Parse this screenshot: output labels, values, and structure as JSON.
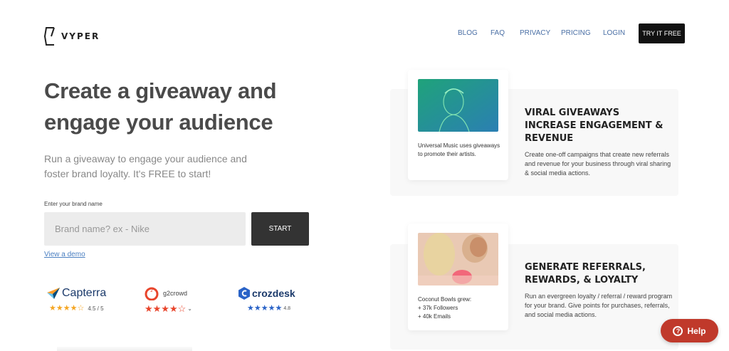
{
  "header": {
    "logo_text": "VYPER",
    "nav": [
      "BLOG",
      "FAQ",
      "PRIVACY",
      "PRICING",
      "LOGIN"
    ],
    "cta": "TRY IT FREE"
  },
  "hero": {
    "title": "Create a giveaway and engage your audience",
    "subtitle": "Run a giveaway to engage your audience and foster brand loyalty. It's FREE to start!",
    "brand_label": "Enter your brand name",
    "brand_placeholder": "Brand name? ex - Nike",
    "start_label": "START",
    "demo_link": "View a demo"
  },
  "ratings": [
    {
      "name": "Capterra",
      "score": "4.5 / 5",
      "stars": 4.5,
      "star_color": "#f5a623"
    },
    {
      "name": "g2crowd",
      "score": "",
      "stars": 4.5,
      "star_color": "#e8452c"
    },
    {
      "name": "crozdesk",
      "score": "4.8",
      "stars": 5,
      "star_color": "#2a63c7"
    }
  ],
  "features": [
    {
      "card_text": "Universal Music uses giveaways to promote their artists.",
      "title": "VIRAL GIVEAWAYS INCREASE ENGAGEMENT & REVENUE",
      "description": "Create one-off campaigns that create new referrals and revenue for your business through viral sharing & social media actions."
    },
    {
      "card_text_lines": [
        "Coconut Bowls grew:",
        "+ 37k Followers",
        "+ 40k Emails"
      ],
      "title": "GENERATE REFERRALS, REWARDS, & LOYALTY",
      "description": "Run an evergreen loyalty / referral / reward program for your brand. Give points for purchases, referrals, and social media actions."
    }
  ],
  "help": {
    "label": "Help",
    "icon": "?"
  },
  "colors": {
    "accent_dark": "#111111",
    "help_red": "#c0392b",
    "link_blue": "#4a7fc1",
    "nav_blue": "#4a6fa5"
  }
}
